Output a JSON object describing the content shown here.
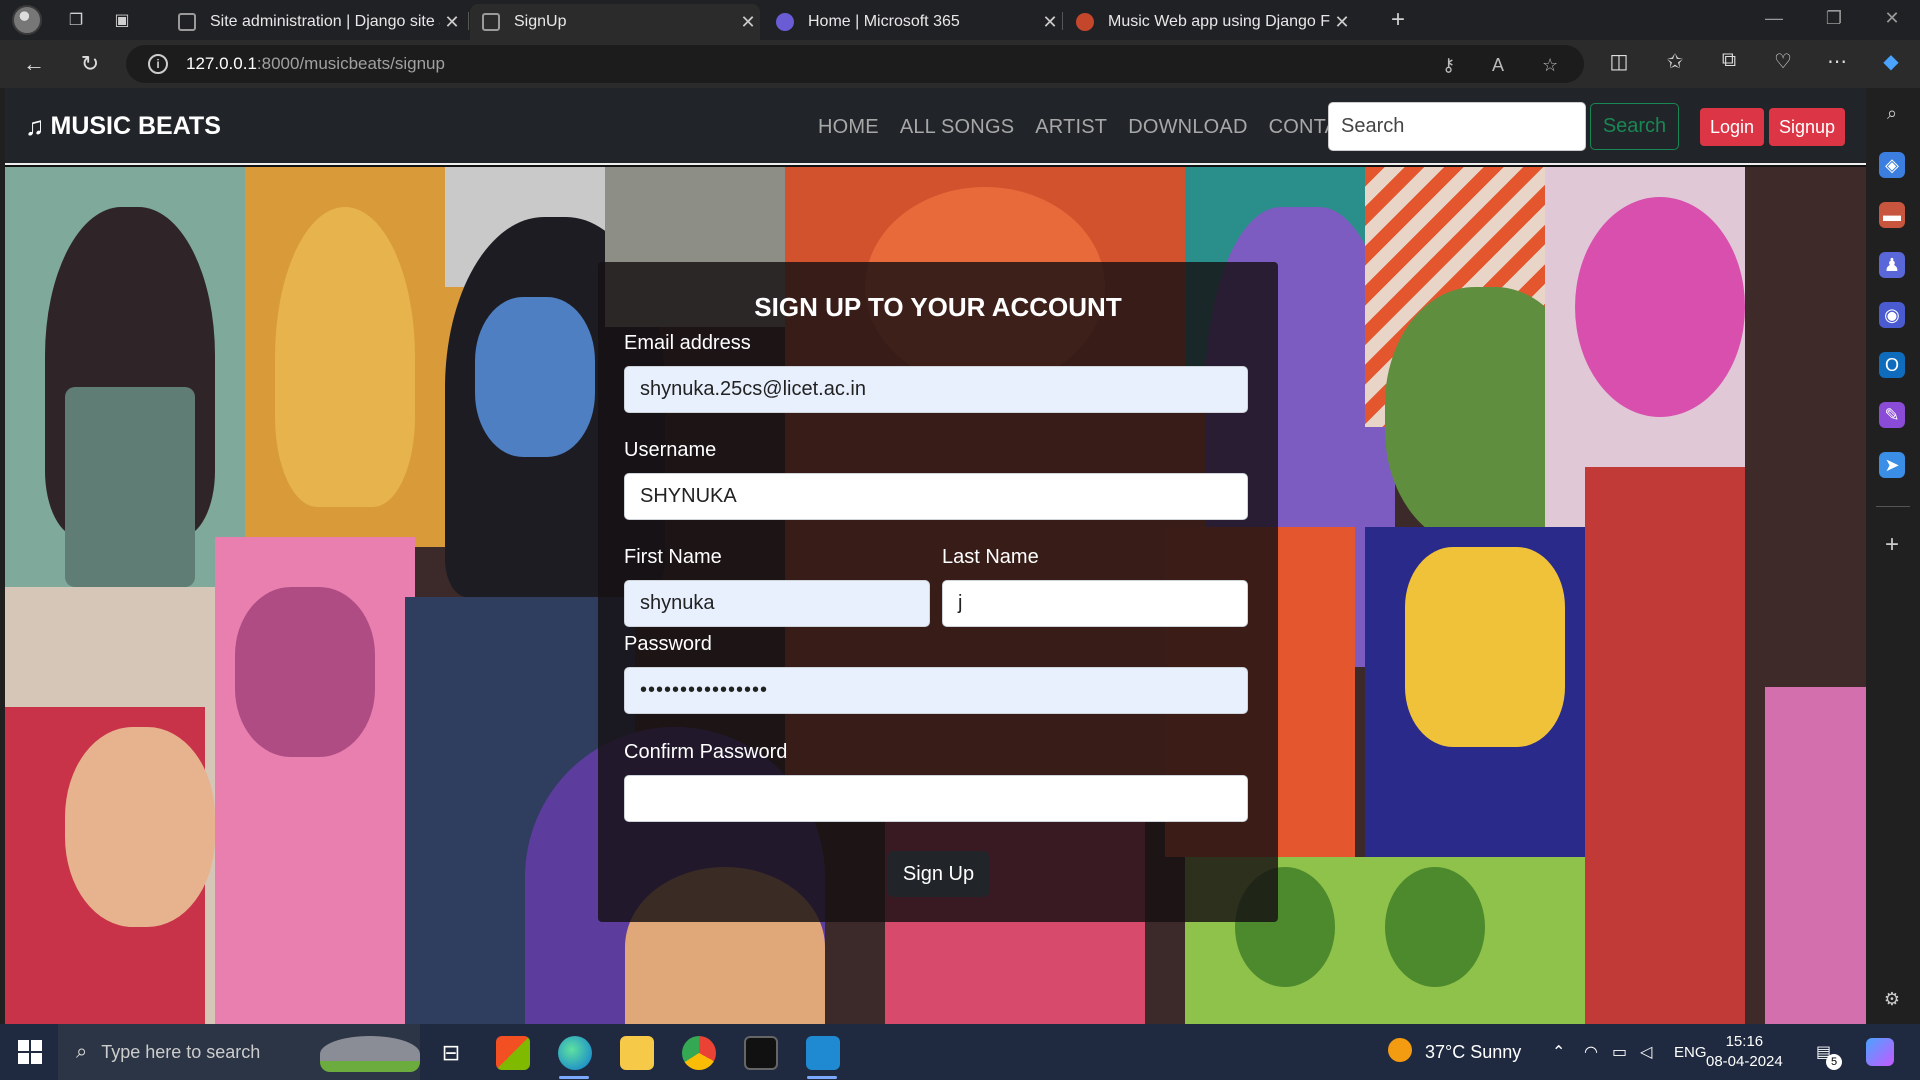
{
  "browser": {
    "tabs": [
      {
        "title": "Site administration | Django site admin",
        "favicon_color": "#8a8a8a"
      },
      {
        "title": "SignUp",
        "favicon_color": "#8a8a8a"
      },
      {
        "title": "Home | Microsoft 365",
        "favicon_color": "#6a5cd4"
      },
      {
        "title": "Music Web app using Django Fra",
        "favicon_color": "#c4472c"
      }
    ],
    "url_host": "127.0.0.1",
    "url_path": ":8000/musicbeats/signup"
  },
  "navbar": {
    "brand": "MUSIC BEATS",
    "links": [
      "HOME",
      "ALL SONGS",
      "ARTIST",
      "DOWNLOAD",
      "CONTACT"
    ],
    "search_placeholder": "Search",
    "search_button": "Search",
    "login_button": "Login",
    "signup_button": "Signup"
  },
  "form": {
    "title": "SIGN UP TO YOUR ACCOUNT",
    "email_label": "Email address",
    "email_value": "shynuka.25cs@licet.ac.in",
    "username_label": "Username",
    "username_value": "SHYNUKA",
    "first_name_label": "First Name",
    "first_name_value": "shynuka",
    "last_name_label": "Last Name",
    "last_name_value": "j",
    "password_label": "Password",
    "password_value": "••••••••••••••••",
    "confirm_label": "Confirm Password",
    "confirm_value": "",
    "submit": "Sign Up"
  },
  "taskbar": {
    "search_placeholder": "Type here to search",
    "weather": "37°C  Sunny",
    "language": "ENG",
    "time": "15:16",
    "date": "08-04-2024",
    "notification_count": "5"
  },
  "colors": {
    "navbar_bg": "#212529",
    "danger": "#dc3545",
    "success": "#198754",
    "autofill": "#e8f0fe"
  }
}
